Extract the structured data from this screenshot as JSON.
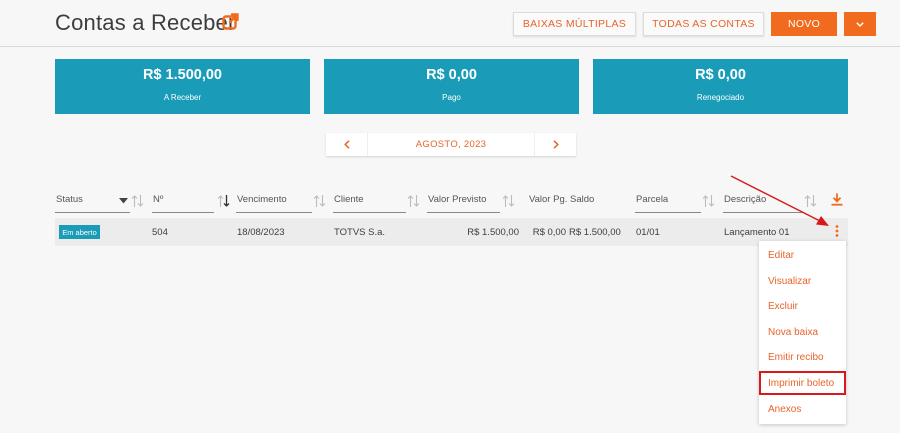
{
  "header": {
    "title": "Contas a Receber",
    "buttons": {
      "baixas_multiplas": "BAIXAS MÚLTIPLAS",
      "todas_as_contas": "TODAS AS CONTAS",
      "novo": "NOVO"
    }
  },
  "summary": [
    {
      "value": "R$ 1.500,00",
      "label": "A Receber"
    },
    {
      "value": "R$ 0,00",
      "label": "Pago"
    },
    {
      "value": "R$ 0,00",
      "label": "Renegociado"
    }
  ],
  "month_selector": {
    "label": "AGOSTO, 2023"
  },
  "table": {
    "columns": [
      "Status",
      "Nº",
      "Vencimento",
      "Cliente",
      "Valor Previsto",
      "Valor Pg.",
      "Saldo",
      "Parcela",
      "Descrição"
    ],
    "rows": [
      {
        "status": "Em aberto",
        "numero": "504",
        "vencimento": "18/08/2023",
        "cliente": "TOTVS S.a.",
        "valor_previsto": "R$ 1.500,00",
        "valor_pago": "R$ 0,00",
        "saldo": "R$ 1.500,00",
        "parcela": "01/01",
        "descricao": "Lançamento 01"
      }
    ]
  },
  "row_menu": {
    "items": [
      "Editar",
      "Visualizar",
      "Excluir",
      "Nova baixa",
      "Emitir recibo",
      "Imprimir boleto",
      "Anexos"
    ],
    "highlighted": "Imprimir boleto"
  },
  "colors": {
    "accent": "#f26a1d",
    "teal": "#1a9bb8",
    "annotation": "#d7191c"
  },
  "icons": [
    "external-link-icon",
    "chevron-down-icon",
    "chevron-left-icon",
    "chevron-right-icon",
    "sort-icon",
    "download-icon",
    "kebab-menu-icon"
  ]
}
